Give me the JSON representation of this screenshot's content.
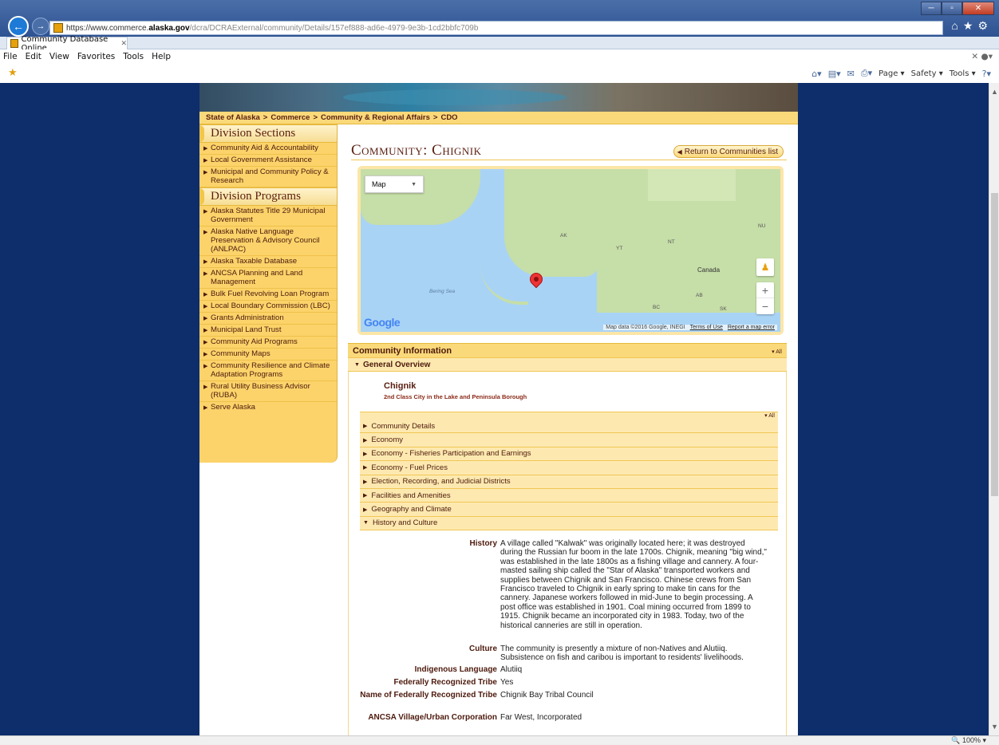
{
  "browser": {
    "url_prefix": "https://www.commerce.",
    "url_domain": "alaska.gov",
    "url_rest": "/dcra/DCRAExternal/community/Details/157ef888-ad6e-4979-9e3b-1cd2bbfc709b",
    "tab_title": "Community Database Online",
    "menu": [
      "File",
      "Edit",
      "View",
      "Favorites",
      "Tools",
      "Help"
    ],
    "cmd": {
      "page": "Page ▾",
      "safety": "Safety ▾",
      "tools": "Tools ▾"
    },
    "zoom": "100%"
  },
  "breadcrumb": [
    "State of Alaska",
    "Commerce",
    "Community & Regional Affairs",
    "CDO"
  ],
  "nav": {
    "sections_heading": "Division Sections",
    "sections": [
      "Community Aid & Accountability",
      "Local Government Assistance",
      "Municipal and Community Policy & Research"
    ],
    "programs_heading": "Division Programs",
    "programs": [
      "Alaska Statutes Title 29 Municipal Government",
      "Alaska Native Language Preservation & Advisory Council (ANLPAC)",
      "Alaska Taxable Database",
      "ANCSA Planning and Land Management",
      "Bulk Fuel Revolving Loan Program",
      "Local Boundary Commission (LBC)",
      "Grants Administration",
      "Municipal Land Trust",
      "Community Aid Programs",
      "Community Maps",
      "Community Resilience and Climate Adaptation Programs",
      "Rural Utility Business Advisor (RUBA)",
      "Serve Alaska"
    ]
  },
  "main": {
    "title": "Community: Chignik",
    "return_label": "Return to Communities list",
    "map": {
      "type_label": "Map",
      "labels": {
        "ak": "AK",
        "yt": "YT",
        "nt": "NT",
        "nu": "NU",
        "canada": "Canada",
        "bering": "Bering Sea",
        "bc": "BC",
        "ab": "AB",
        "sk": "SK"
      },
      "logo": "Google",
      "attribution": "Map data ©2016 Google, INEGI",
      "terms": "Terms of Use",
      "report": "Report a map error"
    },
    "info_heading": "Community Information",
    "all_label": "▾ All",
    "overview_label": "General Overview",
    "community_name": "Chignik",
    "community_class": "2nd Class City in the Lake and Peninsula Borough",
    "sections": [
      "Community Details",
      "Economy",
      "Economy - Fisheries Participation and Earnings",
      "Economy - Fuel Prices",
      "Election, Recording, and Judicial Districts",
      "Facilities and Amenities",
      "Geography and Climate",
      "History and Culture"
    ],
    "history": [
      {
        "label": "History",
        "value": "A village called \"Kalwak\" was originally located here; it was destroyed during the Russian fur boom in the late 1700s. Chignik, meaning \"big wind,\" was established in the late 1800s as a fishing village and cannery. A four-masted sailing ship called the \"Star of Alaska\" transported workers and supplies between Chignik and San Francisco. Chinese crews from San Francisco traveled to Chignik in early spring to make tin cans for the cannery. Japanese workers followed in mid-June to begin processing. A post office was established in 1901. Coal mining occurred from 1899 to 1915. Chignik became an incorporated city in 1983. Today, two of the historical canneries are still in operation."
      },
      {
        "label": "Culture",
        "value": "The community is presently a mixture of non-Natives and Alutiiq. Subsistence on fish and caribou is important to residents' livelihoods."
      },
      {
        "label": "Indigenous Language",
        "value": "Alutiiq"
      },
      {
        "label": "Federally Recognized Tribe",
        "value": "Yes"
      },
      {
        "label": "Name of Federally Recognized Tribe",
        "value": "Chignik Bay Tribal Council"
      },
      {
        "label": "ANCSA Village/Urban Corporation",
        "value": "Far West, Incorporated"
      }
    ]
  }
}
